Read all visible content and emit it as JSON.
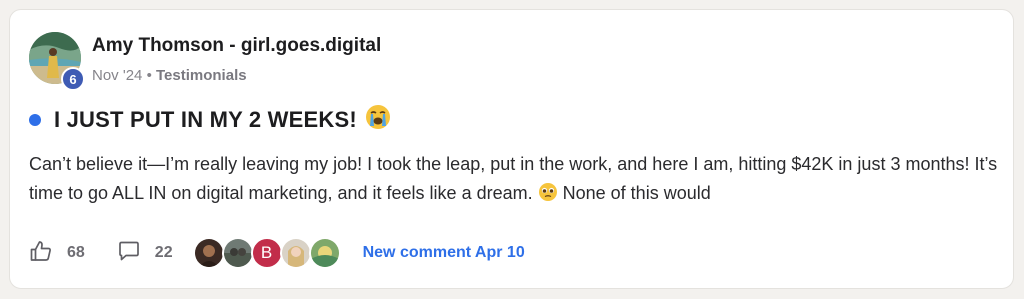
{
  "post": {
    "author": {
      "name": "Amy Thomson - girl.goes.digital",
      "level": "6"
    },
    "date": "Nov '24",
    "separator": "•",
    "category": "Testimonials",
    "unread": true,
    "title": "I JUST PUT IN MY 2 WEEKS!",
    "title_emoji": "loudly-crying-face",
    "body_part1": "Can’t believe it—I’m really leaving my job! I took the leap, put in the work, and here I am, hitting $42K in just 3 months! It’s time to go ALL IN on digital marketing, and it feels like a dream.",
    "body_emoji": "pleading-face",
    "body_part2": "None of this would",
    "likes": "68",
    "comments": "22",
    "commenters": [
      {
        "type": "photo",
        "name": "commenter-1"
      },
      {
        "type": "photo",
        "name": "commenter-2"
      },
      {
        "type": "letter",
        "letter": "B"
      },
      {
        "type": "photo",
        "name": "commenter-4"
      },
      {
        "type": "photo",
        "name": "commenter-5"
      }
    ],
    "new_comment_label": "New comment Apr 10"
  },
  "colors": {
    "accent": "#2e6fe8",
    "level_badge": "#3e5bb4",
    "letter_avatar": "#c22d4a"
  }
}
